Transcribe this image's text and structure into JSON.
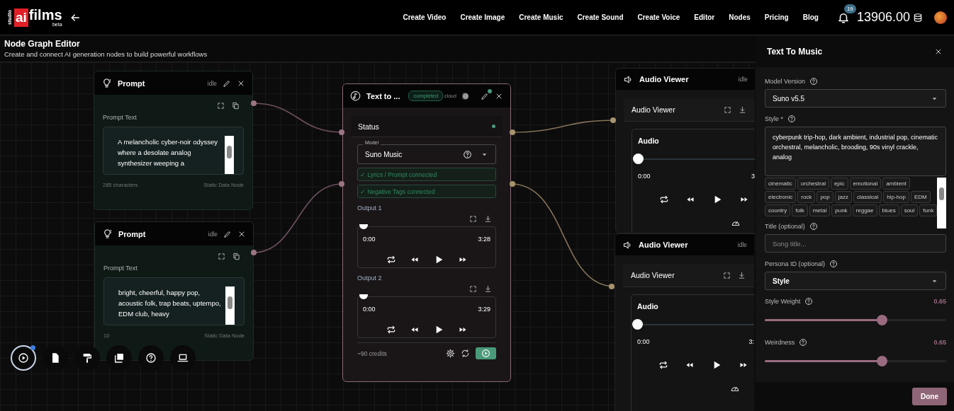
{
  "nav": {
    "logo": {
      "small": "studio",
      "mark": "ai",
      "word": "films",
      "tag": "beta"
    },
    "links": [
      "Create Video",
      "Create Image",
      "Create Music",
      "Create Sound",
      "Create Voice",
      "Editor",
      "Nodes",
      "Pricing",
      "Blog"
    ],
    "notifications": "19",
    "balance": "13906.00"
  },
  "page": {
    "title": "Node Graph Editor",
    "subtitle": "Create and connect AI generation nodes to build powerful workflows"
  },
  "prompt_nodes": [
    {
      "title": "Prompt",
      "status": "idle",
      "field_label": "Prompt Text",
      "text": "A melancholic cyber-noir odyssey where a desolate analog synthesizer weeping a",
      "char_count": "285 characters",
      "node_type": "Static Data Node"
    },
    {
      "title": "Prompt",
      "status": "idle",
      "field_label": "Prompt Text",
      "text": "bright, cheerful, happy pop, acoustic folk, trap beats, uptempo, EDM club, heavy",
      "char_count": "10",
      "node_type": "Static Data Node"
    }
  ],
  "music_node": {
    "title": "Text to ...",
    "status": "completed",
    "cloud_label": "cloud",
    "cloud_on": false,
    "section": "Status",
    "model_label": "Model",
    "model": "Suno Music",
    "connections": [
      "✓ Lyrics / Prompt connected",
      "✓ Negative Tags connected"
    ],
    "outputs": [
      {
        "label": "Output 1",
        "current": "0:00",
        "duration": "3:28",
        "level": 0
      },
      {
        "label": "Output 2",
        "current": "0:00",
        "duration": "3:29",
        "level": 0
      }
    ],
    "credits": "~90 credits"
  },
  "audio_viewers": [
    {
      "title": "Audio Viewer",
      "status": "idle",
      "subtitle": "Audio Viewer",
      "player_title": "Audio",
      "current": "0:00",
      "duration": "3",
      "level": 0
    },
    {
      "title": "Audio Viewer",
      "status": "idle",
      "subtitle": "Audio Viewer",
      "player_title": "Audio",
      "current": "0:00",
      "duration": "3:",
      "level": 0
    }
  ],
  "toolbar": [
    {
      "kind": "play",
      "selected": true
    },
    {
      "kind": "document",
      "selected": false
    },
    {
      "kind": "roller",
      "selected": false
    },
    {
      "kind": "images",
      "selected": false
    },
    {
      "kind": "help",
      "selected": false
    },
    {
      "kind": "laptop",
      "selected": false
    }
  ],
  "panel": {
    "title": "Text To Music",
    "model_version_label": "Model Version",
    "model_version": "Suno v5.5",
    "style_label": "Style *",
    "style_text": "cyberpunk trip-hop, dark ambient, industrial pop, cinematic orchestral, melancholic, brooding, 90s vinyl crackle, analog",
    "tags": [
      "cinematic",
      "orchestral",
      "epic",
      "emotional",
      "ambient",
      "electronic",
      "rock",
      "pop",
      "jazz",
      "classical",
      "hip-hop",
      "EDM",
      "country",
      "folk",
      "metal",
      "punk",
      "reggae",
      "blues",
      "soul",
      "funk"
    ],
    "title_label": "Title (optional)",
    "title_placeholder": "Song title...",
    "persona_label": "Persona ID (optional)",
    "persona": "Style",
    "sliders": [
      {
        "label": "Style Weight",
        "reading": "0.65",
        "level": 0.65
      },
      {
        "label": "Weirdness",
        "reading": "0.65",
        "level": 0.65
      }
    ],
    "done": "Done"
  }
}
